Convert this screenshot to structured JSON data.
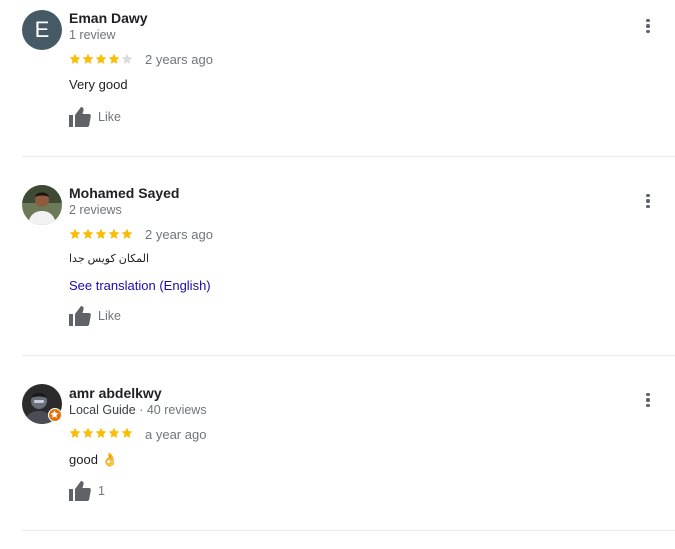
{
  "reviews": [
    {
      "avatar_letter": "E",
      "avatar_color": "#455a64",
      "name": "Eman Dawy",
      "meta": "1 review",
      "rating": 4,
      "time": "2 years ago",
      "text": "Very good",
      "like_label": "Like"
    },
    {
      "name": "Mohamed Sayed",
      "meta": "2 reviews",
      "rating": 5,
      "time": "2 years ago",
      "text": "المكان كويس جدا",
      "translate_label": "See translation (English)",
      "like_label": "Like"
    },
    {
      "name": "amr abdelkwy",
      "guide_label": "Local Guide",
      "meta": " · 40 reviews",
      "rating": 5,
      "time": "a year ago",
      "text": "good 👌",
      "like_label": "1"
    }
  ],
  "colors": {
    "star_filled": "#fbbc04",
    "star_empty": "#dadce0",
    "link": "#1a0dab",
    "guide_badge": "#e8710a"
  },
  "icons": {
    "like": "thumb-up-icon",
    "more": "more-vert-icon",
    "star": "star-icon",
    "guide": "local-guide-badge-icon"
  }
}
